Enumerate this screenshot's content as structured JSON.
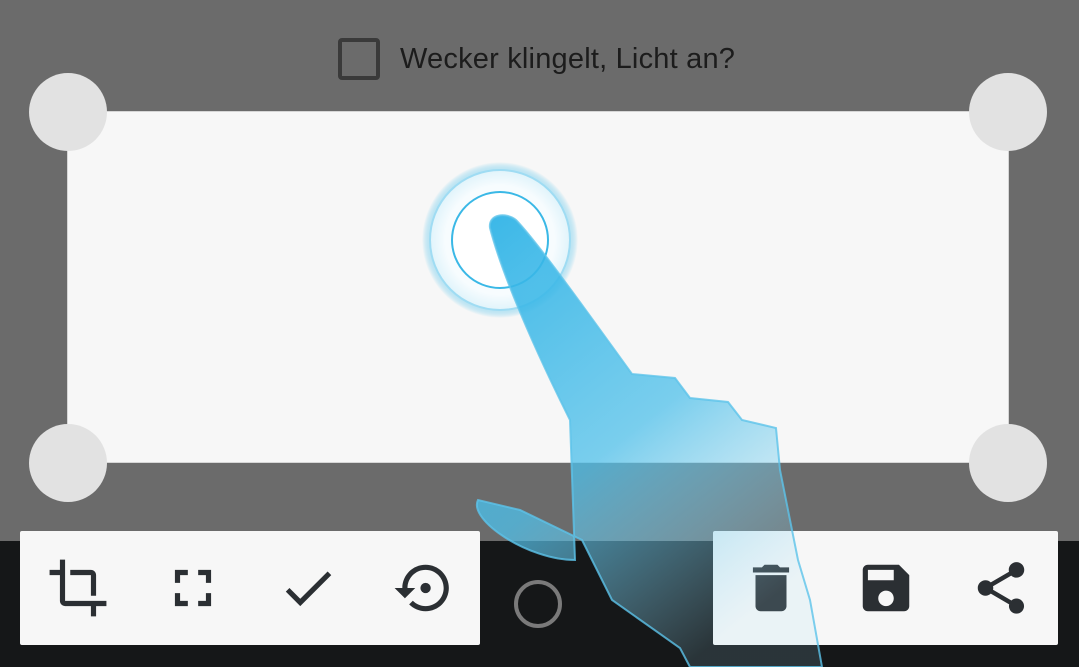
{
  "checkbox": {
    "label": "Wecker klingelt, Licht an?",
    "checked": false
  },
  "toolbar_left": [
    {
      "icon": "crop-icon"
    },
    {
      "icon": "fullscreen-icon"
    },
    {
      "icon": "check-icon"
    },
    {
      "icon": "restore-icon"
    }
  ],
  "toolbar_right": [
    {
      "icon": "delete-icon"
    },
    {
      "icon": "save-icon"
    },
    {
      "icon": "share-icon"
    }
  ],
  "colors": {
    "background": "#6b6b6b",
    "crop_area": "#f7f7f7",
    "handles": "#e2e2e2",
    "icon": "#2b2f33",
    "gesture": "#3ab8e6",
    "nav_bar": "#151718"
  }
}
